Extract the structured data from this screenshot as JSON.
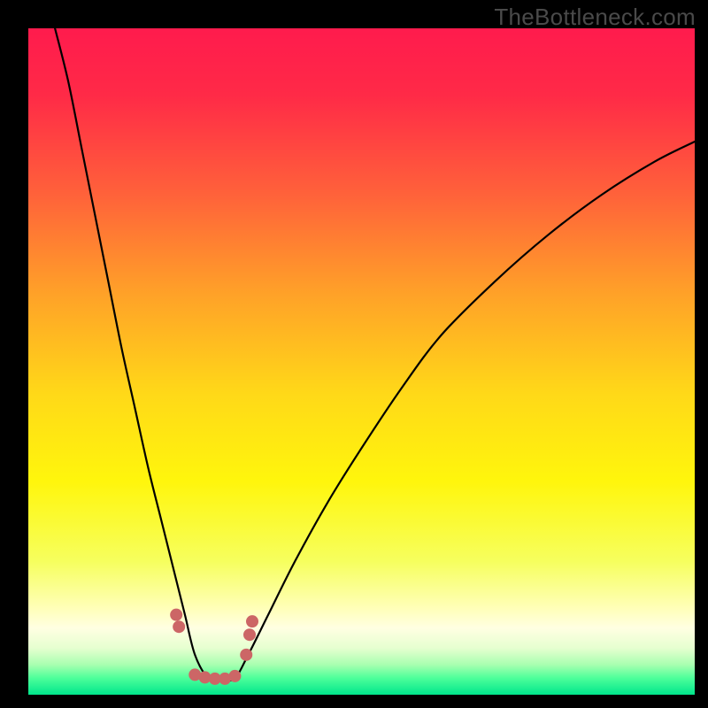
{
  "watermark": "TheBottleneck.com",
  "chart_data": {
    "type": "line",
    "title": "",
    "xlabel": "",
    "ylabel": "",
    "xlim": [
      0,
      100
    ],
    "ylim": [
      0,
      100
    ],
    "grid": false,
    "legend": false,
    "background_gradient": {
      "stops": [
        {
          "offset": 0.0,
          "color": "#ff1b4d"
        },
        {
          "offset": 0.1,
          "color": "#ff2a47"
        },
        {
          "offset": 0.25,
          "color": "#ff623a"
        },
        {
          "offset": 0.4,
          "color": "#ffa228"
        },
        {
          "offset": 0.55,
          "color": "#ffd918"
        },
        {
          "offset": 0.68,
          "color": "#fff60c"
        },
        {
          "offset": 0.8,
          "color": "#f6ff5e"
        },
        {
          "offset": 0.87,
          "color": "#ffffb8"
        },
        {
          "offset": 0.9,
          "color": "#ffffe2"
        },
        {
          "offset": 0.93,
          "color": "#e6ffd0"
        },
        {
          "offset": 0.955,
          "color": "#a8ffb0"
        },
        {
          "offset": 0.975,
          "color": "#4dff9a"
        },
        {
          "offset": 1.0,
          "color": "#00e68c"
        }
      ]
    },
    "series": [
      {
        "name": "curve",
        "stroke": "#000000",
        "stroke_width": 2.2,
        "x": [
          4,
          6,
          8,
          10,
          12,
          14,
          16,
          18,
          20,
          22,
          23.5,
          25,
          27,
          29,
          31,
          33,
          36,
          40,
          45,
          50,
          56,
          62,
          70,
          78,
          86,
          94,
          100
        ],
        "values": [
          100,
          92,
          82,
          72,
          62,
          52,
          43,
          34,
          26,
          18,
          12,
          6,
          2.5,
          2.2,
          2.5,
          6,
          12,
          20,
          29,
          37,
          46,
          54,
          62,
          69,
          75,
          80,
          83
        ]
      }
    ],
    "markers": {
      "name": "dots",
      "color": "#cc6666",
      "radius_px": 7,
      "x": [
        22.2,
        22.6,
        25.0,
        26.5,
        28.0,
        29.5,
        31.0,
        32.7,
        33.2,
        33.6
      ],
      "values": [
        12.0,
        10.2,
        3.0,
        2.6,
        2.4,
        2.4,
        2.8,
        6.0,
        9.0,
        11.0
      ]
    }
  }
}
